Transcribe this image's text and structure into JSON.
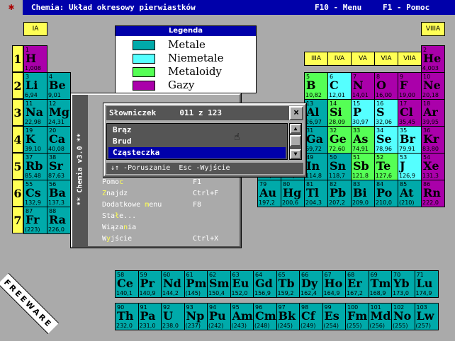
{
  "titlebar": {
    "system_icon": "✱",
    "title": "Chemia: Układ okresowy pierwiastków",
    "f10": "F10 - Menu",
    "f1": "F1 - Pomoc"
  },
  "colors": {
    "metal": "#00aaaa",
    "nonmetal": "#55ffff",
    "metalloid": "#55ff55",
    "gas": "#aa00aa",
    "group": "#ffff55",
    "title": "#0000aa"
  },
  "legend": {
    "title": "Legenda",
    "items": [
      {
        "label": "Metale",
        "color": "#00aaaa"
      },
      {
        "label": "Niemetale",
        "color": "#55ffff"
      },
      {
        "label": "Metaloidy",
        "color": "#55ff55"
      },
      {
        "label": "Gazy",
        "color": "#aa00aa"
      }
    ]
  },
  "groups": [
    "IA",
    "IIIA",
    "IVA",
    "VA",
    "VIA",
    "VIIA",
    "VIIIA"
  ],
  "periods": [
    "1",
    "2",
    "3",
    "4",
    "5",
    "6",
    "7"
  ],
  "elements": [
    {
      "z": "1",
      "s": "H",
      "m": "1,008",
      "t": "gas"
    },
    {
      "z": "2",
      "s": "He",
      "m": "4,003",
      "t": "gas"
    },
    {
      "z": "3",
      "s": "Li",
      "m": "6,94",
      "t": "metal"
    },
    {
      "z": "4",
      "s": "Be",
      "m": "9,01",
      "t": "metal"
    },
    {
      "z": "5",
      "s": "B",
      "m": "10,82",
      "t": "metalloid"
    },
    {
      "z": "6",
      "s": "C",
      "m": "12,01",
      "t": "nonmetal"
    },
    {
      "z": "7",
      "s": "N",
      "m": "14,01",
      "t": "gas"
    },
    {
      "z": "8",
      "s": "O",
      "m": "16,00",
      "t": "gas"
    },
    {
      "z": "9",
      "s": "F",
      "m": "19,00",
      "t": "gas"
    },
    {
      "z": "10",
      "s": "Ne",
      "m": "20,18",
      "t": "gas"
    },
    {
      "z": "11",
      "s": "Na",
      "m": "22,98",
      "t": "metal"
    },
    {
      "z": "12",
      "s": "Mg",
      "m": "24,31",
      "t": "metal"
    },
    {
      "z": "13",
      "s": "Al",
      "m": "26,97",
      "t": "metal"
    },
    {
      "z": "14",
      "s": "Si",
      "m": "28,09",
      "t": "metalloid"
    },
    {
      "z": "15",
      "s": "P",
      "m": "30,97",
      "t": "nonmetal"
    },
    {
      "z": "16",
      "s": "S",
      "m": "32,06",
      "t": "nonmetal"
    },
    {
      "z": "17",
      "s": "Cl",
      "m": "35,45",
      "t": "gas"
    },
    {
      "z": "18",
      "s": "Ar",
      "m": "39,95",
      "t": "gas"
    },
    {
      "z": "19",
      "s": "K",
      "m": "39,10",
      "t": "metal"
    },
    {
      "z": "20",
      "s": "Ca",
      "m": "40,08",
      "t": "metal"
    },
    {
      "z": "31",
      "s": "Ga",
      "m": "69,72",
      "t": "metal"
    },
    {
      "z": "32",
      "s": "Ge",
      "m": "72,60",
      "t": "metalloid"
    },
    {
      "z": "33",
      "s": "As",
      "m": "74,91",
      "t": "metalloid"
    },
    {
      "z": "34",
      "s": "Se",
      "m": "78,96",
      "t": "nonmetal"
    },
    {
      "z": "35",
      "s": "Br",
      "m": "79,91",
      "t": "nonmetal"
    },
    {
      "z": "36",
      "s": "Kr",
      "m": "83,80",
      "t": "gas"
    },
    {
      "z": "37",
      "s": "Rb",
      "m": "85,48",
      "t": "metal"
    },
    {
      "z": "38",
      "s": "Sr",
      "m": "87,63",
      "t": "metal"
    },
    {
      "z": "47",
      "s": "Ag",
      "m": "107,9",
      "t": "metal"
    },
    {
      "z": "48",
      "s": "Cd",
      "m": "112,4",
      "t": "metal"
    },
    {
      "z": "49",
      "s": "In",
      "m": "114,8",
      "t": "metal"
    },
    {
      "z": "50",
      "s": "Sn",
      "m": "118,7",
      "t": "metal"
    },
    {
      "z": "51",
      "s": "Sb",
      "m": "121,8",
      "t": "metalloid"
    },
    {
      "z": "52",
      "s": "Te",
      "m": "127,6",
      "t": "metalloid"
    },
    {
      "z": "53",
      "s": "J",
      "m": "126,9",
      "t": "nonmetal"
    },
    {
      "z": "54",
      "s": "Xe",
      "m": "131,3",
      "t": "gas"
    },
    {
      "z": "55",
      "s": "Cs",
      "m": "132,9",
      "t": "metal"
    },
    {
      "z": "56",
      "s": "Ba",
      "m": "137,3",
      "t": "metal"
    },
    {
      "z": "79",
      "s": "Au",
      "m": "197,2",
      "t": "metal"
    },
    {
      "z": "80",
      "s": "Hg",
      "m": "200,6",
      "t": "metal"
    },
    {
      "z": "81",
      "s": "Tl",
      "m": "204,3",
      "t": "metal"
    },
    {
      "z": "82",
      "s": "Pb",
      "m": "207,2",
      "t": "metal"
    },
    {
      "z": "83",
      "s": "Bi",
      "m": "209,0",
      "t": "metal"
    },
    {
      "z": "84",
      "s": "Po",
      "m": "210,0",
      "t": "metal"
    },
    {
      "z": "85",
      "s": "At",
      "m": "(210)",
      "t": "metal"
    },
    {
      "z": "86",
      "s": "Rn",
      "m": "222,0",
      "t": "gas"
    },
    {
      "z": "87",
      "s": "Fr",
      "m": "(223)",
      "t": "metal"
    },
    {
      "z": "88",
      "s": "Ra",
      "m": "226,0",
      "t": "metal"
    },
    {
      "z": "58",
      "s": "Ce",
      "m": "140,1",
      "t": "metal"
    },
    {
      "z": "59",
      "s": "Pr",
      "m": "140,9",
      "t": "metal"
    },
    {
      "z": "60",
      "s": "Nd",
      "m": "144,2",
      "t": "metal"
    },
    {
      "z": "61",
      "s": "Pm",
      "m": "(145)",
      "t": "metal"
    },
    {
      "z": "62",
      "s": "Sm",
      "m": "150,4",
      "t": "metal"
    },
    {
      "z": "63",
      "s": "Eu",
      "m": "152,0",
      "t": "metal"
    },
    {
      "z": "64",
      "s": "Gd",
      "m": "156,9",
      "t": "metal"
    },
    {
      "z": "65",
      "s": "Tb",
      "m": "159,2",
      "t": "metal"
    },
    {
      "z": "66",
      "s": "Dy",
      "m": "162,4",
      "t": "metal"
    },
    {
      "z": "67",
      "s": "Ho",
      "m": "164,9",
      "t": "metal"
    },
    {
      "z": "68",
      "s": "Er",
      "m": "167,2",
      "t": "metal"
    },
    {
      "z": "69",
      "s": "Tm",
      "m": "168,9",
      "t": "metal"
    },
    {
      "z": "70",
      "s": "Yb",
      "m": "173,0",
      "t": "metal"
    },
    {
      "z": "71",
      "s": "Lu",
      "m": "174,9",
      "t": "metal"
    },
    {
      "z": "90",
      "s": "Th",
      "m": "232,0",
      "t": "metal"
    },
    {
      "z": "91",
      "s": "Pa",
      "m": "231,0",
      "t": "metal"
    },
    {
      "z": "92",
      "s": "U",
      "m": "238,0",
      "t": "metal"
    },
    {
      "z": "93",
      "s": "Np",
      "m": "(237)",
      "t": "metal"
    },
    {
      "z": "94",
      "s": "Pu",
      "m": "(242)",
      "t": "metal"
    },
    {
      "z": "95",
      "s": "Am",
      "m": "(243)",
      "t": "metal"
    },
    {
      "z": "96",
      "s": "Cm",
      "m": "(248)",
      "t": "metal"
    },
    {
      "z": "97",
      "s": "Bk",
      "m": "(245)",
      "t": "metal"
    },
    {
      "z": "98",
      "s": "Cf",
      "m": "(249)",
      "t": "metal"
    },
    {
      "z": "99",
      "s": "Es",
      "m": "(254)",
      "t": "metal"
    },
    {
      "z": "100",
      "s": "Fm",
      "m": "(255)",
      "t": "metal"
    },
    {
      "z": "101",
      "s": "Md",
      "m": "(256)",
      "t": "metal"
    },
    {
      "z": "102",
      "s": "No",
      "m": "(255)",
      "t": "metal"
    },
    {
      "z": "103",
      "s": "Lw",
      "m": "(257)",
      "t": "metal"
    }
  ],
  "menu": {
    "vertical_title": "** Chemia v3.0 **",
    "items": [
      {
        "pre": "Pomo",
        "hk": "c",
        "post": "",
        "key": "F1"
      },
      {
        "pre": "",
        "hk": "Z",
        "post": "najdz",
        "key": "Ctrl+F"
      },
      {
        "pre": "Dodatkowe ",
        "hk": "m",
        "post": "enu",
        "key": "F8"
      },
      {
        "pre": "Sta",
        "hk": "ł",
        "post": "e...",
        "key": ""
      },
      {
        "pre": "Wiąza",
        "hk": "n",
        "post": "ia",
        "key": ""
      },
      {
        "pre": "W",
        "hk": "y",
        "post": "jście",
        "key": "Ctrl+X"
      }
    ]
  },
  "dictionary": {
    "title": "Słowniczek",
    "counter": "011 z 123",
    "close": "×",
    "items": [
      {
        "label": "Brąz",
        "selected": false
      },
      {
        "label": "Brud",
        "selected": false
      },
      {
        "label": "Cząsteczka",
        "selected": true
      }
    ],
    "scroll_up": "▲",
    "scroll_down": "▼",
    "status": "↓↑ -Poruszanie  Esc -Wyjście"
  },
  "badge": "FREEWARE"
}
